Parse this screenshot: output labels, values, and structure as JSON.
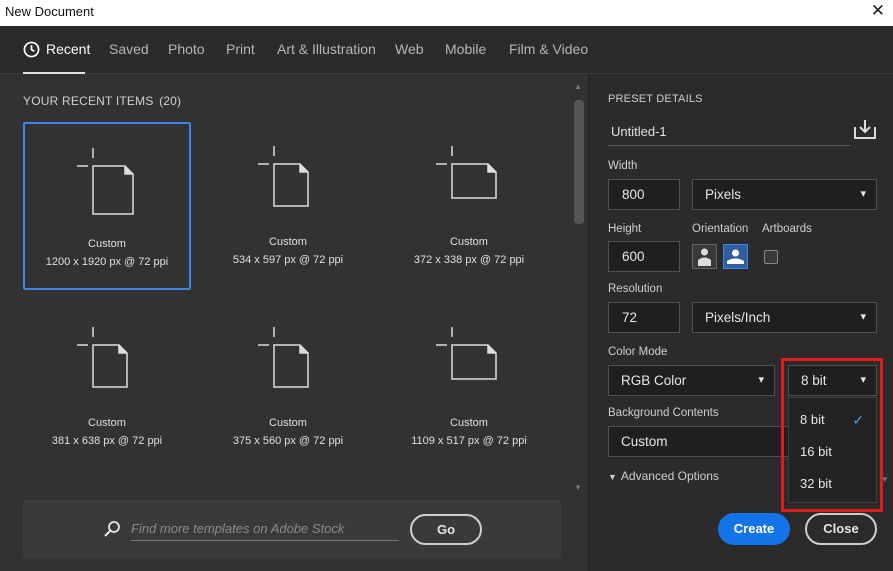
{
  "window": {
    "title": "New Document",
    "close_glyph": "✕"
  },
  "tabs": [
    {
      "label": "Recent"
    },
    {
      "label": "Saved"
    },
    {
      "label": "Photo"
    },
    {
      "label": "Print"
    },
    {
      "label": "Art & Illustration"
    },
    {
      "label": "Web"
    },
    {
      "label": "Mobile"
    },
    {
      "label": "Film & Video"
    }
  ],
  "recent": {
    "heading": "YOUR RECENT ITEMS",
    "count": "(20)",
    "items": [
      {
        "name": "Custom",
        "dims": "1200 x 1920 px @ 72 ppi",
        "orientation": "portrait",
        "selected": true
      },
      {
        "name": "Custom",
        "dims": "534 x 597 px @ 72 ppi",
        "orientation": "portrait"
      },
      {
        "name": "Custom",
        "dims": "372 x 338 px @ 72 ppi",
        "orientation": "landscape"
      },
      {
        "name": "Custom",
        "dims": "381 x 638 px @ 72 ppi",
        "orientation": "portrait"
      },
      {
        "name": "Custom",
        "dims": "375 x 560 px @ 72 ppi",
        "orientation": "portrait"
      },
      {
        "name": "Custom",
        "dims": "1109 x 517 px @ 72 ppi",
        "orientation": "landscape"
      }
    ]
  },
  "stock": {
    "placeholder": "Find more templates on Adobe Stock",
    "go_label": "Go"
  },
  "preset": {
    "heading": "PRESET DETAILS",
    "doc_name": "Untitled-1",
    "width_label": "Width",
    "width_value": "800",
    "width_unit": "Pixels",
    "height_label": "Height",
    "height_value": "600",
    "orientation_label": "Orientation",
    "artboards_label": "Artboards",
    "resolution_label": "Resolution",
    "resolution_value": "72",
    "resolution_unit": "Pixels/Inch",
    "color_mode_label": "Color Mode",
    "color_mode_value": "RGB Color",
    "bit_depth_value": "8 bit",
    "background_label": "Background Contents",
    "background_value": "Custom",
    "advanced_label": "Advanced Options"
  },
  "bit_menu": {
    "options": [
      "8 bit",
      "16 bit",
      "32 bit"
    ],
    "selected_index": 0
  },
  "buttons": {
    "create": "Create",
    "close": "Close"
  },
  "colors": {
    "accent": "#1473e6",
    "selection": "#3c87e6",
    "highlight": "#e31b1b"
  }
}
